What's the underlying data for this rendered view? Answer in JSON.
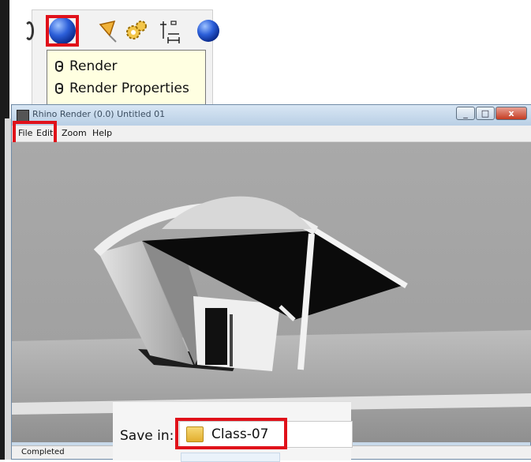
{
  "toolbar": {
    "tooltip_items": [
      "Render",
      "Render Properties"
    ]
  },
  "render_window": {
    "title": "Rhino Render (0.0) Untitled 01",
    "controls": [
      "_",
      "□",
      "x"
    ],
    "menu": [
      "File",
      "Edit",
      "Zoom",
      "Help"
    ],
    "status": "Completed"
  },
  "save_dialog": {
    "save_in_label": "Save in:",
    "folder": "Class-07"
  },
  "colors": {
    "highlight": "#e0111a",
    "tooltip_bg": "#ffffe1",
    "viewport_bg": "#a6a6a6"
  }
}
